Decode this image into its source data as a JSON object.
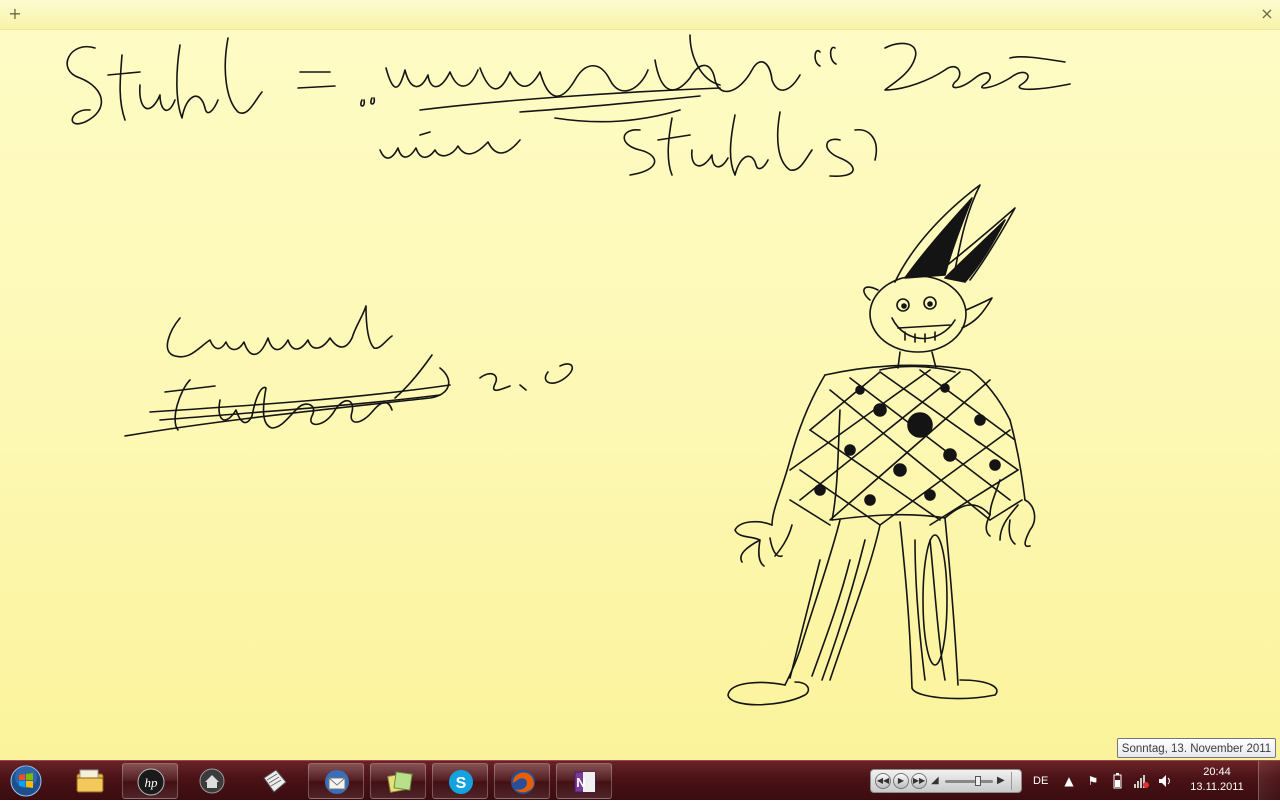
{
  "note": {
    "new_label": "+",
    "close_label": "×",
    "colors": {
      "paper": "#fdf8b4",
      "ink": "#141414"
    }
  },
  "taskbar": {
    "colors": {
      "bar": "#4a1216"
    },
    "pinned": [
      {
        "name": "start-orb-icon"
      },
      {
        "name": "windows-explorer-icon"
      },
      {
        "name": "hp-icon"
      },
      {
        "name": "home-icon"
      },
      {
        "name": "notes-app-icon"
      },
      {
        "name": "thunderbird-icon"
      },
      {
        "name": "sticky-notes-icon"
      },
      {
        "name": "skype-icon"
      },
      {
        "name": "firefox-icon"
      },
      {
        "name": "onenote-icon"
      }
    ],
    "language": "DE",
    "clock": {
      "time": "20:44",
      "date": "13.11.2011"
    },
    "tooltip": "Sonntag, 13. November 2011"
  }
}
